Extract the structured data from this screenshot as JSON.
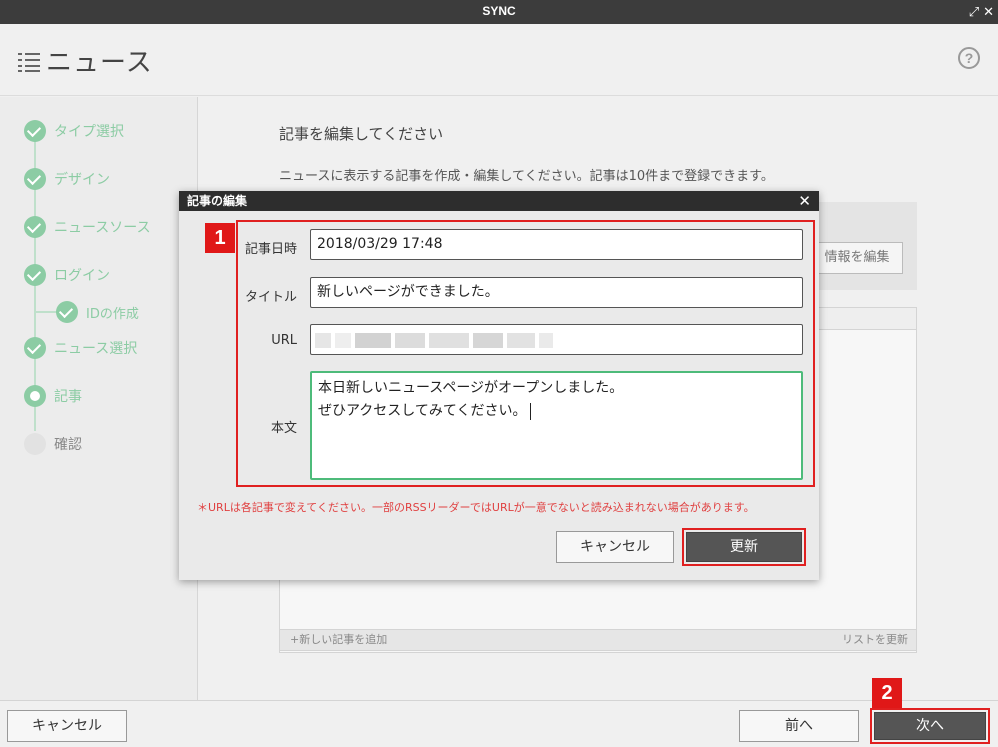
{
  "window": {
    "title": "SYNC",
    "expand_glyph": "⤢",
    "close_glyph": "✕"
  },
  "header": {
    "title": "ニュース",
    "help_glyph": "?"
  },
  "steps": [
    {
      "label": "タイプ選択",
      "state": "done"
    },
    {
      "label": "デザイン",
      "state": "done"
    },
    {
      "label": "ニュースソース",
      "state": "done"
    },
    {
      "label": "ログイン",
      "state": "done"
    },
    {
      "label": "IDの作成",
      "state": "done",
      "sub": true
    },
    {
      "label": "ニュース選択",
      "state": "done"
    },
    {
      "label": "記事",
      "state": "current"
    },
    {
      "label": "確認",
      "state": "pending"
    }
  ],
  "main": {
    "title": "記事を編集してください",
    "description": "ニュースに表示する記事を作成・編集してください。記事は10件まで登録できます。",
    "edit_info_button": "情報を編集",
    "add_article": "+新しい記事を追加",
    "refresh_list": "リストを更新"
  },
  "dialog": {
    "title": "記事の編集",
    "close_glyph": "✕",
    "fields": {
      "date_label": "記事日時",
      "date_value": "2018/03/29 17:48",
      "title_label": "タイトル",
      "title_value": "新しいページができました。",
      "url_label": "URL",
      "body_label": "本文",
      "body_line1": "本日新しいニュースページがオープンしました。",
      "body_line2": "ぜひアクセスしてみてください。"
    },
    "note": "＊URLは各記事で変えてください。一部のRSSリーダーではURLが一意でないと読み込まれない場合があります。",
    "cancel_button": "キャンセル",
    "update_button": "更新"
  },
  "footer": {
    "cancel_button": "キャンセル",
    "back_button": "前へ",
    "next_button": "次へ"
  },
  "annotations": {
    "badge1": "1",
    "badge2": "2"
  },
  "colors": {
    "accent_green": "#8ccca4",
    "highlight_red": "#e02020",
    "titlebar": "#3c3c3c"
  }
}
